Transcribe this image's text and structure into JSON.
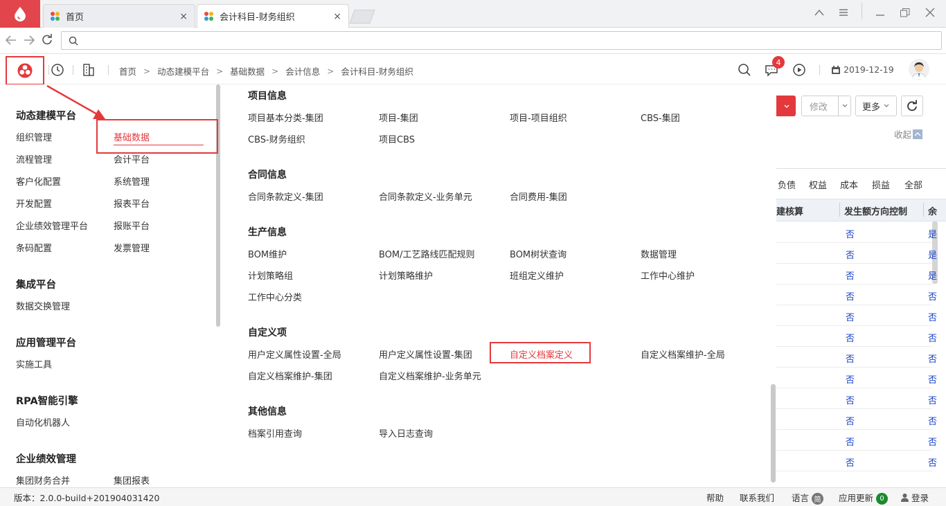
{
  "browser": {
    "tabs": [
      {
        "label": "首页"
      },
      {
        "label": "会计科目-财务组织"
      }
    ],
    "close_glyph": "×",
    "window_controls": [
      "tab-list-icon",
      "menu-icon",
      "minimize-icon",
      "restore-icon",
      "close-icon"
    ]
  },
  "header": {
    "breadcrumb": [
      "首页",
      "动态建模平台",
      "基础数据",
      "会计信息",
      "会计科目-财务组织"
    ],
    "notification_count": "4",
    "date": "2019-12-19"
  },
  "left_menu": {
    "groups": [
      {
        "title": "动态建模平台",
        "items": [
          "组织管理",
          "基础数据",
          "流程管理",
          "会计平台",
          "客户化配置",
          "系统管理",
          "开发配置",
          "报表平台",
          "企业绩效管理平台",
          "报账平台",
          "条码配置",
          "发票管理"
        ]
      },
      {
        "title": "集成平台",
        "items": [
          "数据交换管理"
        ]
      },
      {
        "title": "应用管理平台",
        "items": [
          "实施工具"
        ]
      },
      {
        "title": "RPA智能引擎",
        "items": [
          "自动化机器人"
        ]
      },
      {
        "title": "企业绩效管理",
        "items": [
          "集团财务合并",
          "集团报表"
        ]
      }
    ],
    "active_item": "基础数据"
  },
  "panel": {
    "sections": [
      {
        "title": "项目信息",
        "links": [
          "项目基本分类-集团",
          "项目-集团",
          "项目-项目组织",
          "CBS-集团",
          "CBS-财务组织",
          "项目CBS"
        ]
      },
      {
        "title": "合同信息",
        "links": [
          "合同条款定义-集团",
          "合同条款定义-业务单元",
          "合同费用-集团"
        ]
      },
      {
        "title": "生产信息",
        "links": [
          "BOM维护",
          "BOM/工艺路线匹配规则",
          "BOM树状查询",
          "数据管理",
          "计划策略组",
          "计划策略维护",
          "班组定义维护",
          "工作中心维护",
          "工作中心分类"
        ]
      },
      {
        "title": "自定义项",
        "links": [
          "用户定义属性设置-全局",
          "用户定义属性设置-集团",
          "自定义档案定义",
          "自定义档案维护-全局",
          "自定义档案维护-集团",
          "自定义档案维护-业务单元"
        ]
      },
      {
        "title": "其他信息",
        "links": [
          "档案引用查询",
          "导入日志查询"
        ]
      }
    ],
    "highlighted_link": "自定义档案定义"
  },
  "background_page": {
    "buttons": {
      "modify": "修改",
      "more": "更多"
    },
    "collapse": "收起",
    "tabs": [
      "负债",
      "权益",
      "成本",
      "损益",
      "全部"
    ],
    "columns": [
      "建核算",
      "发生额方向控制",
      "余"
    ],
    "rows": [
      "否",
      "否",
      "否",
      "否",
      "否",
      "否",
      "否",
      "否",
      "否",
      "否",
      "否",
      "否"
    ],
    "row_tail": [
      "是",
      "是",
      "是",
      "否",
      "否",
      "否",
      "否",
      "否",
      "否",
      "否",
      "否",
      "否"
    ]
  },
  "footer": {
    "version": "版本：2.0.0-build+201904031420",
    "help": "帮助",
    "contact": "联系我们",
    "language": "语言",
    "language_badge": "简",
    "update": "应用更新",
    "update_count": "0",
    "login": "登录"
  },
  "colors": {
    "accent": "#e4393c",
    "link_blue": "#1a44c4",
    "badge_green": "#1b8a2e"
  }
}
